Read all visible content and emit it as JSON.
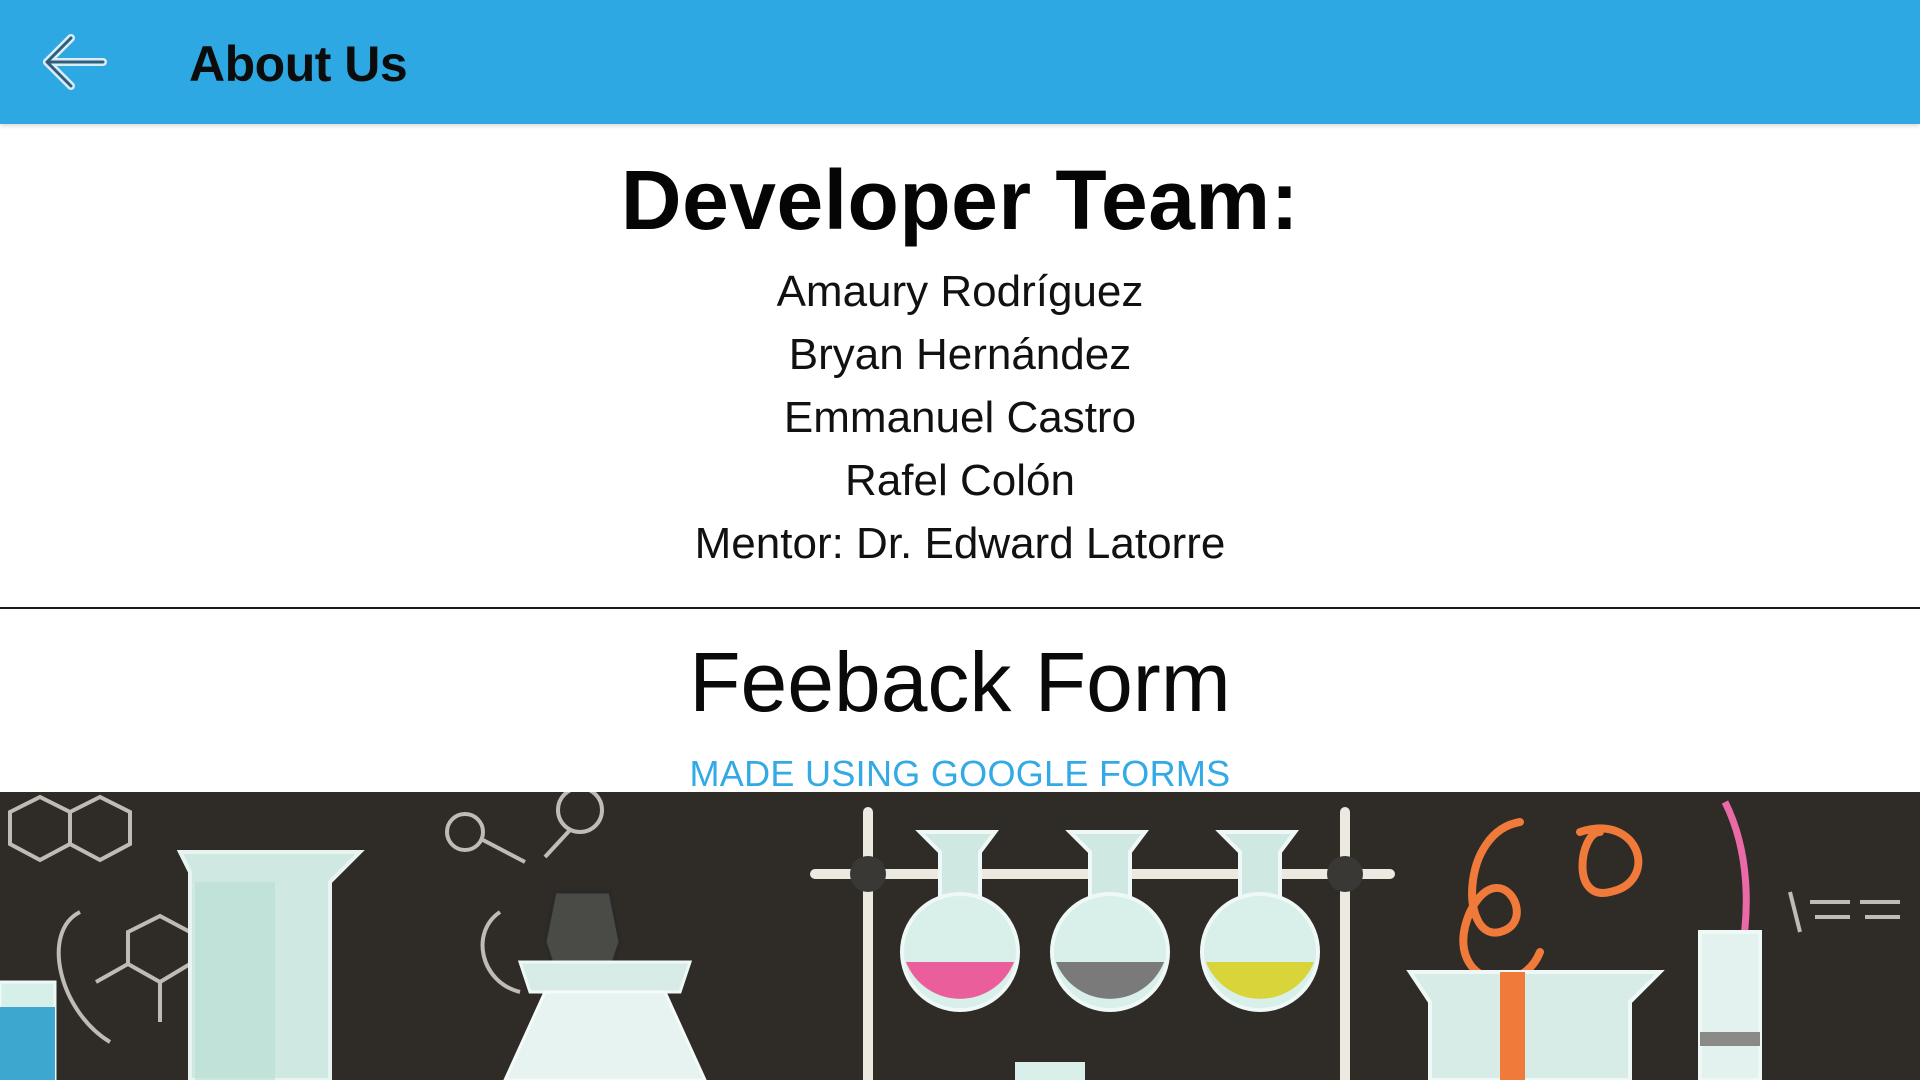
{
  "app_bar": {
    "title": "About Us",
    "back_icon": "arrow-left-icon",
    "color": "#2ea8e3"
  },
  "team": {
    "heading": "Developer Team:",
    "members": [
      "Amaury Rodríguez",
      "Bryan Hernández",
      "Emmanuel Castro",
      "Rafel Colón",
      "Mentor: Dr. Edward Latorre"
    ]
  },
  "feedback": {
    "heading": "Feeback Form",
    "link_label": "MADE USING GOOGLE FORMS",
    "link_color": "#33a9e6"
  },
  "banner": {
    "description_icon": "chemistry-lab-illustration",
    "liquid_colors": [
      "#ea5f9b",
      "#7a7a7a",
      "#d9d43a"
    ]
  }
}
